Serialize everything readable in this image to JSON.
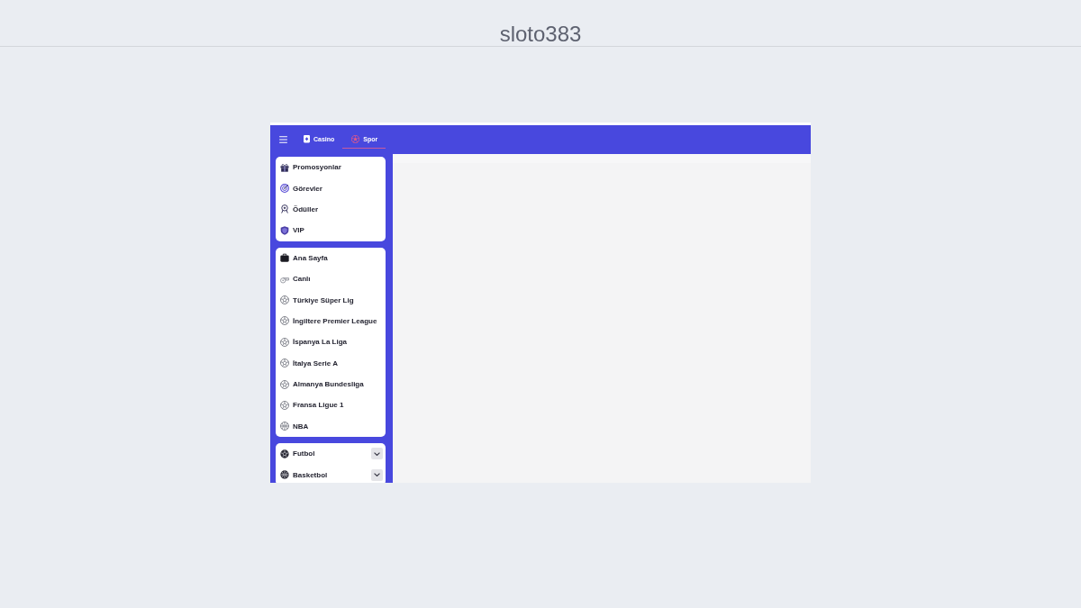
{
  "page_title": "sloto383",
  "app": {
    "top_bar": {
      "tabs": [
        {
          "label": "Casino",
          "selected": false
        },
        {
          "label": "Spor",
          "selected": true
        }
      ]
    },
    "sidebar": {
      "groups": [
        {
          "items": [
            {
              "label": "Promosyonlar"
            },
            {
              "label": "Görevler"
            },
            {
              "label": "Ödüller"
            },
            {
              "label": "VIP"
            }
          ]
        },
        {
          "items": [
            {
              "label": "Ana Sayfa"
            },
            {
              "label": "Canlı"
            },
            {
              "label": "Türkiye Süper Lig"
            },
            {
              "label": "İngiltere Premier League"
            },
            {
              "label": "İspanya La Liga"
            },
            {
              "label": "İtalya Serie A"
            },
            {
              "label": "Almanya Bundesliga"
            },
            {
              "label": "Fransa Ligue 1"
            },
            {
              "label": "NBA"
            }
          ]
        },
        {
          "items": [
            {
              "label": "Futbol",
              "expanded": false
            },
            {
              "label": "Basketbol",
              "expanded": false
            }
          ]
        }
      ]
    }
  }
}
